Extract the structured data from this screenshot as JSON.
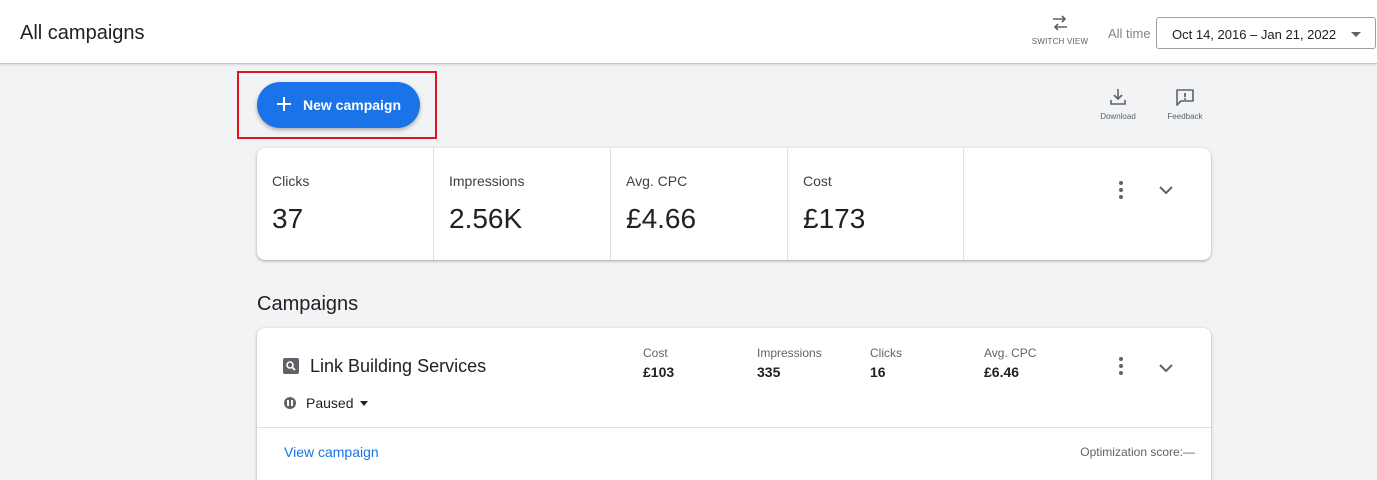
{
  "header": {
    "title": "All campaigns",
    "switch_view_label": "SWITCH VIEW",
    "date_range_label": "All time",
    "date_range_value": "Oct 14, 2016 – Jan 21, 2022"
  },
  "actions": {
    "new_campaign_label": "New campaign",
    "download_label": "Download",
    "feedback_label": "Feedback"
  },
  "summary": {
    "metrics": [
      {
        "label": "Clicks",
        "value": "37"
      },
      {
        "label": "Impressions",
        "value": "2.56K"
      },
      {
        "label": "Avg. CPC",
        "value": "£4.66"
      },
      {
        "label": "Cost",
        "value": "£173"
      }
    ]
  },
  "campaigns": {
    "section_title": "Campaigns",
    "items": [
      {
        "icon": "search-campaign-icon",
        "name": "Link Building Services",
        "status": "Paused",
        "stats": [
          {
            "label": "Cost",
            "value": "£103"
          },
          {
            "label": "Impressions",
            "value": "335"
          },
          {
            "label": "Clicks",
            "value": "16"
          },
          {
            "label": "Avg. CPC",
            "value": "£6.46"
          }
        ],
        "view_link": "View campaign",
        "optimization_score": "Optimization score:—"
      }
    ]
  },
  "colors": {
    "primary": "#1a73e8",
    "highlight": "#e1141f",
    "background": "#f1f3f4"
  }
}
